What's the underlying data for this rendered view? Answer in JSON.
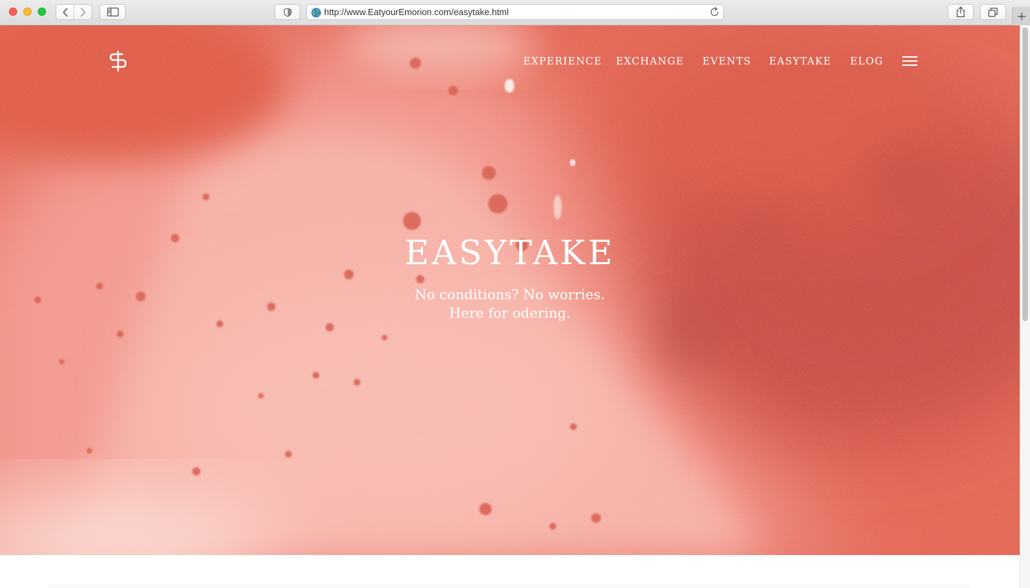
{
  "browser": {
    "url": "http://www.EatyourEmorion.com/easytake.html",
    "icons": {
      "back": "chevron-left-icon",
      "forward": "chevron-right-icon",
      "sidebar": "sidebar-icon",
      "privacy": "shield-icon",
      "site": "globe-icon",
      "reload": "reload-icon",
      "share": "share-icon",
      "tabs": "tabs-overview-icon",
      "new_tab": "plus-icon"
    }
  },
  "site": {
    "logo_icon": "s-monogram-logo-icon",
    "nav": {
      "items": [
        {
          "label": "EXPERIENCE"
        },
        {
          "label": "EXCHANGE"
        },
        {
          "label": "EVENTS"
        },
        {
          "label": "EASYTAKE"
        },
        {
          "label": "ELOG"
        }
      ],
      "menu_icon": "hamburger-menu-icon"
    },
    "hero": {
      "title": "EASYTAKE",
      "subtitle_line1": "No conditions? No worries.",
      "subtitle_line2": "Here for odering."
    }
  },
  "colors": {
    "hero_red": "#e3604f",
    "hero_pink": "#f5a59a",
    "text": "#ffffff"
  }
}
